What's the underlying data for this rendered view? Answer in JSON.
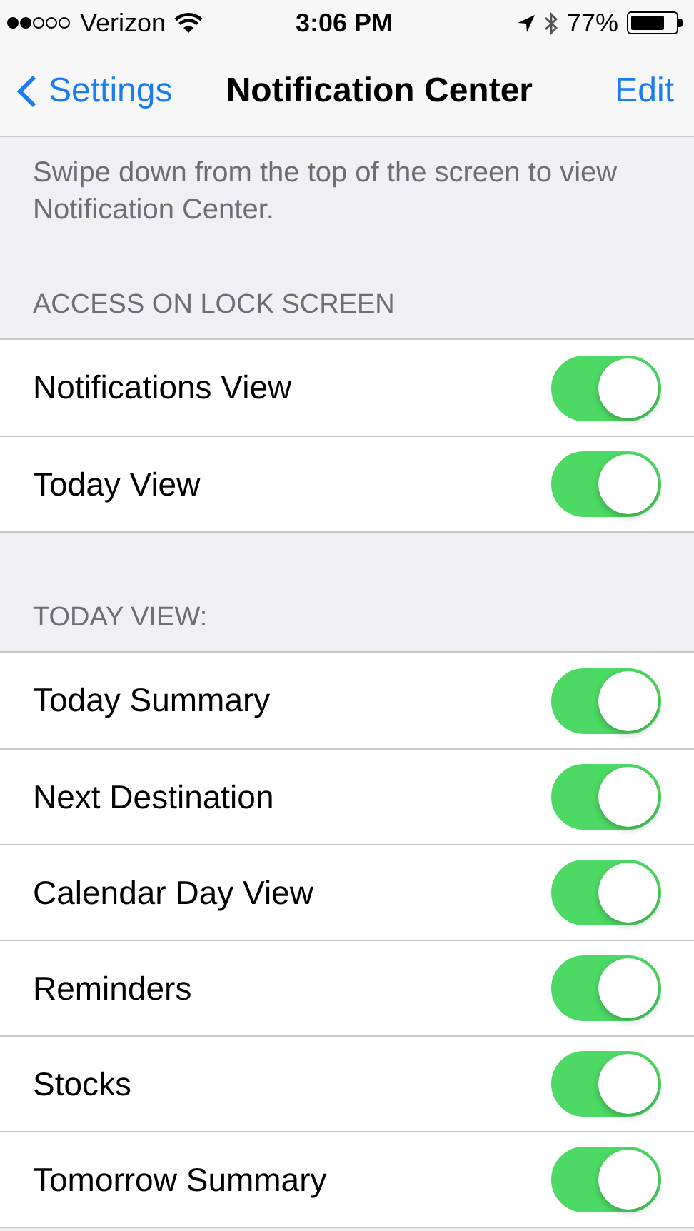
{
  "status_bar": {
    "carrier": "Verizon",
    "time": "3:06 PM",
    "battery": "77%"
  },
  "nav": {
    "back": "Settings",
    "title": "Notification Center",
    "action": "Edit"
  },
  "description": "Swipe down from the top of the screen to view Notification Center.",
  "sections": [
    {
      "header": "ACCESS ON LOCK SCREEN",
      "rows": [
        {
          "label": "Notifications View",
          "on": true
        },
        {
          "label": "Today View",
          "on": true
        }
      ]
    },
    {
      "header": "TODAY VIEW:",
      "rows": [
        {
          "label": "Today Summary",
          "on": true
        },
        {
          "label": "Next Destination",
          "on": true
        },
        {
          "label": "Calendar Day View",
          "on": true
        },
        {
          "label": "Reminders",
          "on": true
        },
        {
          "label": "Stocks",
          "on": true
        },
        {
          "label": "Tomorrow Summary",
          "on": true
        }
      ]
    }
  ]
}
